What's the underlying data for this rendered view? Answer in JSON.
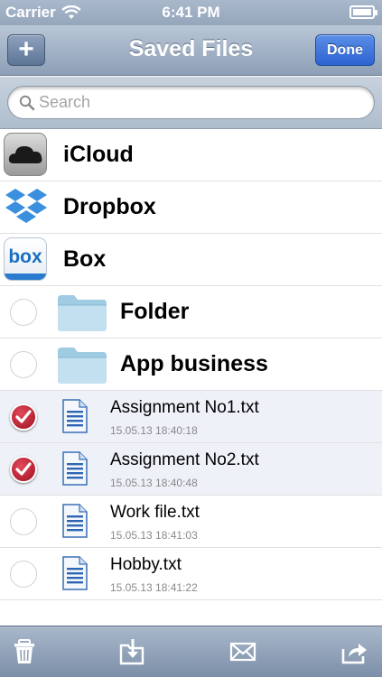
{
  "status_bar": {
    "carrier": "Carrier",
    "time": "6:41 PM"
  },
  "nav": {
    "title": "Saved Files",
    "add_label": "+",
    "done_label": "Done"
  },
  "search": {
    "placeholder": "Search",
    "value": ""
  },
  "services": [
    {
      "label": "iCloud",
      "icon": "icloud-icon"
    },
    {
      "label": "Dropbox",
      "icon": "dropbox-icon"
    },
    {
      "label": "Box",
      "icon": "box-icon",
      "logo_text": "box"
    }
  ],
  "folders": [
    {
      "label": "Folder",
      "checked": false
    },
    {
      "label": "App business",
      "checked": false
    }
  ],
  "files": [
    {
      "name": "Assignment No1.txt",
      "date": "15.05.13 18:40:18",
      "checked": true
    },
    {
      "name": "Assignment No2.txt",
      "date": "15.05.13 18:40:48",
      "checked": true
    },
    {
      "name": "Work file.txt",
      "date": "15.05.13 18:41:03",
      "checked": false
    },
    {
      "name": "Hobby.txt",
      "date": "15.05.13 18:41:22",
      "checked": false
    }
  ],
  "toolbar": {
    "items": [
      "trash-icon",
      "move-to-folder-icon",
      "mail-icon",
      "share-icon"
    ]
  },
  "colors": {
    "nav_gradient_top": "#b9c6d6",
    "done_button": "#2c63cf",
    "checkmark": "#c0182b",
    "selected_row": "#eef1f8"
  }
}
